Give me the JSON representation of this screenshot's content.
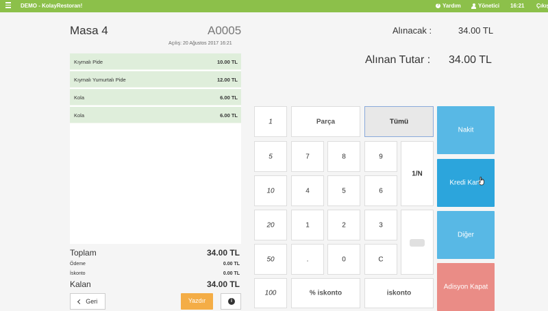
{
  "header": {
    "title": "DEMO - KolayRestoran!",
    "help": "Yardım",
    "user": "Yönetici",
    "time": "16:21",
    "logout": "Çıkış"
  },
  "bill": {
    "table_name": "Masa 4",
    "bill_number": "A0005",
    "opened_at": "Açılış: 20 Ağustos 2017 16:21",
    "items": [
      {
        "name": "Kıymalı Pide",
        "price": "10.00 TL"
      },
      {
        "name": "Kıymalı Yumurtalı Pide",
        "price": "12.00 TL"
      },
      {
        "name": "Kola",
        "price": "6.00 TL"
      },
      {
        "name": "Kola",
        "price": "6.00 TL"
      }
    ],
    "summary": {
      "total_label": "Toplam",
      "total": "34.00 TL",
      "payment_label": "Ödeme",
      "payment": "0.00 TL",
      "discount_label": "İskonto",
      "discount": "0.00 TL",
      "remaining_label": "Kalan",
      "remaining": "34.00 TL"
    },
    "buttons": {
      "back": "Geri",
      "print": "Yazdır"
    }
  },
  "payment": {
    "receivable_label": "Alınacak :",
    "receivable": "34.00 TL",
    "received_label": "Alınan Tutar :",
    "received": "34.00 TL"
  },
  "keypad": {
    "mode_one": "1",
    "partial": "Parça",
    "all": "Tümü",
    "quick_values": [
      "5",
      "10",
      "20",
      "50",
      "100"
    ],
    "digits": [
      "7",
      "8",
      "9",
      "4",
      "5",
      "6",
      "1",
      "2",
      "3",
      ".",
      "0",
      "C"
    ],
    "split": "1/N",
    "percent_discount": "% iskonto",
    "discount": "iskonto"
  },
  "methods": {
    "cash": "Nakit",
    "card": "Kredi Kartı",
    "other": "Diğer",
    "close_bill": "Adisyon Kapat"
  },
  "colors": {
    "top_bar": "#8cc04a",
    "bill_row": "#dfeedb",
    "cash_button": "#58b8e5",
    "card_button": "#2ca5dc",
    "close_button": "#ea8c86",
    "print_button": "#f4ad46"
  },
  "icons": [
    "menu-icon",
    "help-icon",
    "user-icon",
    "chevron-left-icon",
    "info-icon",
    "hand-pointer-icon"
  ]
}
